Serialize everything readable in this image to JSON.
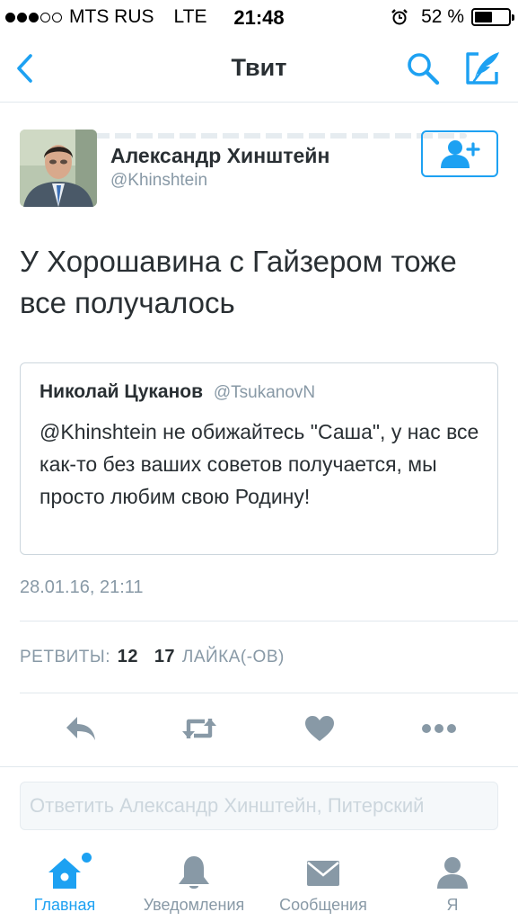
{
  "status_bar": {
    "carrier": "MTS RUS",
    "network": "LTE",
    "time": "21:48",
    "battery_percent": "52 %",
    "battery_level": 0.52,
    "signal_bars_filled": 3,
    "signal_bars_total": 5
  },
  "nav": {
    "title": "Твит"
  },
  "author": {
    "name": "Александр Хинштейн",
    "handle": "@Khinshtein"
  },
  "tweet": {
    "text": "У Хорошавина с Гайзером тоже все получалось",
    "timestamp": "28.01.16, 21:11"
  },
  "quoted": {
    "name": "Николай Цуканов",
    "handle": "@TsukanovN",
    "text": "@Khinshtein не обижайтесь \"Саша\", у нас все как-то без ваших советов получается, мы просто любим свою Родину!"
  },
  "stats": {
    "retweets_label": "РЕТВИТЫ:",
    "retweets_count": "12",
    "likes_count": "17",
    "likes_label": "ЛАЙКА(-ОВ)"
  },
  "reply": {
    "placeholder": "Ответить Александр Хинштейн, Питерский"
  },
  "tabs": [
    {
      "label": "Главная",
      "icon": "home-icon"
    },
    {
      "label": "Уведомления",
      "icon": "bell-icon"
    },
    {
      "label": "Сообщения",
      "icon": "envelope-icon"
    },
    {
      "label": "Я",
      "icon": "person-icon"
    }
  ],
  "colors": {
    "accent": "#1da1f2",
    "muted": "#8899a6",
    "text": "#292f33",
    "action_icon": "#8899a6"
  }
}
